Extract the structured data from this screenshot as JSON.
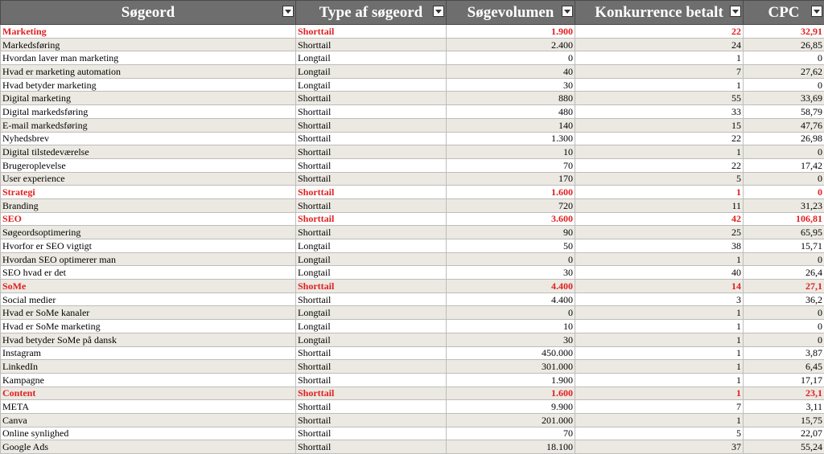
{
  "headers": [
    "Søgeord",
    "Type af søgeord",
    "Søgevolumen",
    "Konkurrence betalt",
    "CPC"
  ],
  "colors": {
    "header_bg": "#6e6e6e",
    "highlight_text": "#e02020",
    "alt_row": "#ece9e2"
  },
  "icons": {
    "header_filter": "filter-dropdown-icon"
  },
  "rows": [
    {
      "keyword": "Marketing",
      "type": "Shorttail",
      "volume": "1.900",
      "competition": "22",
      "cpc": "32,91",
      "highlight": true
    },
    {
      "keyword": "Markedsføring",
      "type": "Shorttail",
      "volume": "2.400",
      "competition": "24",
      "cpc": "26,85",
      "highlight": false
    },
    {
      "keyword": "Hvordan laver man marketing",
      "type": "Longtail",
      "volume": "0",
      "competition": "1",
      "cpc": "0",
      "highlight": false
    },
    {
      "keyword": "Hvad er marketing automation",
      "type": "Longtail",
      "volume": "40",
      "competition": "7",
      "cpc": "27,62",
      "highlight": false
    },
    {
      "keyword": "Hvad betyder marketing",
      "type": "Longtail",
      "volume": "30",
      "competition": "1",
      "cpc": "0",
      "highlight": false
    },
    {
      "keyword": "Digital marketing",
      "type": "Shorttail",
      "volume": "880",
      "competition": "55",
      "cpc": "33,69",
      "highlight": false
    },
    {
      "keyword": "Digital markedsføring",
      "type": "Shorttail",
      "volume": "480",
      "competition": "33",
      "cpc": "58,79",
      "highlight": false
    },
    {
      "keyword": "E-mail markedsføring",
      "type": "Shorttail",
      "volume": "140",
      "competition": "15",
      "cpc": "47,76",
      "highlight": false
    },
    {
      "keyword": "Nyhedsbrev",
      "type": "Shorttail",
      "volume": "1.300",
      "competition": "22",
      "cpc": "26,98",
      "highlight": false
    },
    {
      "keyword": "Digital tilstedeværelse",
      "type": "Shorttail",
      "volume": "10",
      "competition": "1",
      "cpc": "0",
      "highlight": false
    },
    {
      "keyword": "Brugeroplevelse",
      "type": "Shorttail",
      "volume": "70",
      "competition": "22",
      "cpc": "17,42",
      "highlight": false
    },
    {
      "keyword": "User experience",
      "type": "Shorttail",
      "volume": "170",
      "competition": "5",
      "cpc": "0",
      "highlight": false
    },
    {
      "keyword": "Strategi",
      "type": "Shorttail",
      "volume": "1.600",
      "competition": "1",
      "cpc": "0",
      "highlight": true
    },
    {
      "keyword": "Branding",
      "type": "Shorttail",
      "volume": "720",
      "competition": "11",
      "cpc": "31,23",
      "highlight": false
    },
    {
      "keyword": "SEO",
      "type": "Shorttail",
      "volume": "3.600",
      "competition": "42",
      "cpc": "106,81",
      "highlight": true
    },
    {
      "keyword": "Søgeordsoptimering",
      "type": "Shorttail",
      "volume": "90",
      "competition": "25",
      "cpc": "65,95",
      "highlight": false
    },
    {
      "keyword": "Hvorfor er SEO vigtigt",
      "type": "Longtail",
      "volume": "50",
      "competition": "38",
      "cpc": "15,71",
      "highlight": false
    },
    {
      "keyword": "Hvordan SEO optimerer man",
      "type": "Longtail",
      "volume": "0",
      "competition": "1",
      "cpc": "0",
      "highlight": false
    },
    {
      "keyword": "SEO hvad er det",
      "type": "Longtail",
      "volume": "30",
      "competition": "40",
      "cpc": "26,4",
      "highlight": false
    },
    {
      "keyword": "SoMe",
      "type": "Shorttail",
      "volume": "4.400",
      "competition": "14",
      "cpc": "27,1",
      "highlight": true
    },
    {
      "keyword": "Social medier",
      "type": "Shorttail",
      "volume": "4.400",
      "competition": "3",
      "cpc": "36,2",
      "highlight": false
    },
    {
      "keyword": "Hvad er SoMe kanaler",
      "type": "Longtail",
      "volume": "0",
      "competition": "1",
      "cpc": "0",
      "highlight": false
    },
    {
      "keyword": "Hvad er SoMe marketing",
      "type": "Longtail",
      "volume": "10",
      "competition": "1",
      "cpc": "0",
      "highlight": false
    },
    {
      "keyword": "Hvad betyder SoMe på dansk",
      "type": "Longtail",
      "volume": "30",
      "competition": "1",
      "cpc": "0",
      "highlight": false
    },
    {
      "keyword": "Instagram",
      "type": "Shorttail",
      "volume": "450.000",
      "competition": "1",
      "cpc": "3,87",
      "highlight": false
    },
    {
      "keyword": "LinkedIn",
      "type": "Shorttail",
      "volume": "301.000",
      "competition": "1",
      "cpc": "6,45",
      "highlight": false
    },
    {
      "keyword": "Kampagne",
      "type": "Shorttail",
      "volume": "1.900",
      "competition": "1",
      "cpc": "17,17",
      "highlight": false
    },
    {
      "keyword": "Content",
      "type": "Shorttail",
      "volume": "1.600",
      "competition": "1",
      "cpc": "23,1",
      "highlight": true
    },
    {
      "keyword": "META",
      "type": "Shorttail",
      "volume": "9.900",
      "competition": "7",
      "cpc": "3,11",
      "highlight": false
    },
    {
      "keyword": "Canva",
      "type": "Shorttail",
      "volume": "201.000",
      "competition": "1",
      "cpc": "15,75",
      "highlight": false
    },
    {
      "keyword": "Online synlighed",
      "type": "Shorttail",
      "volume": "70",
      "competition": "5",
      "cpc": "22,07",
      "highlight": false
    },
    {
      "keyword": "Google Ads",
      "type": "Shorttail",
      "volume": "18.100",
      "competition": "37",
      "cpc": "55,24",
      "highlight": false
    }
  ]
}
